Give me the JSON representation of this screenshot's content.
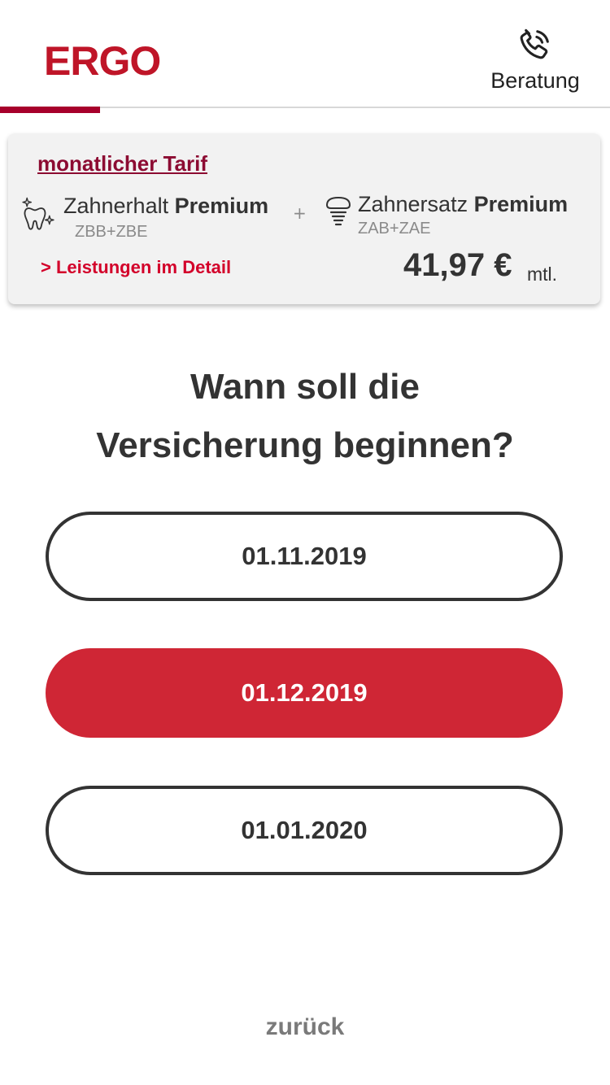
{
  "header": {
    "logo": "ERGO",
    "consult_label": "Beratung",
    "brand_color": "#bf1528",
    "indicator_color": "#a7002b"
  },
  "tariff": {
    "title": "monatlicher Tarif",
    "product1": {
      "name": "Zahnerhalt",
      "level": "Premium",
      "code": "ZBB+ZBE",
      "icon": "tooth-sparkle-icon"
    },
    "plus": "+",
    "product2": {
      "name": "Zahnersatz",
      "level": "Premium",
      "code": "ZAB+ZAE",
      "icon": "dental-implant-icon"
    },
    "details_link": "> Leistungen im Detail",
    "price": "41,97 €",
    "price_unit": "mtl."
  },
  "question": {
    "line1": "Wann soll die",
    "line2": "Versicherung beginnen?"
  },
  "dates": {
    "options": [
      "01.11.2019",
      "01.12.2019",
      "01.01.2020"
    ],
    "selected": "01.12.2019",
    "selected_color": "#cf2635"
  },
  "footer": {
    "back_label": "zurück"
  }
}
